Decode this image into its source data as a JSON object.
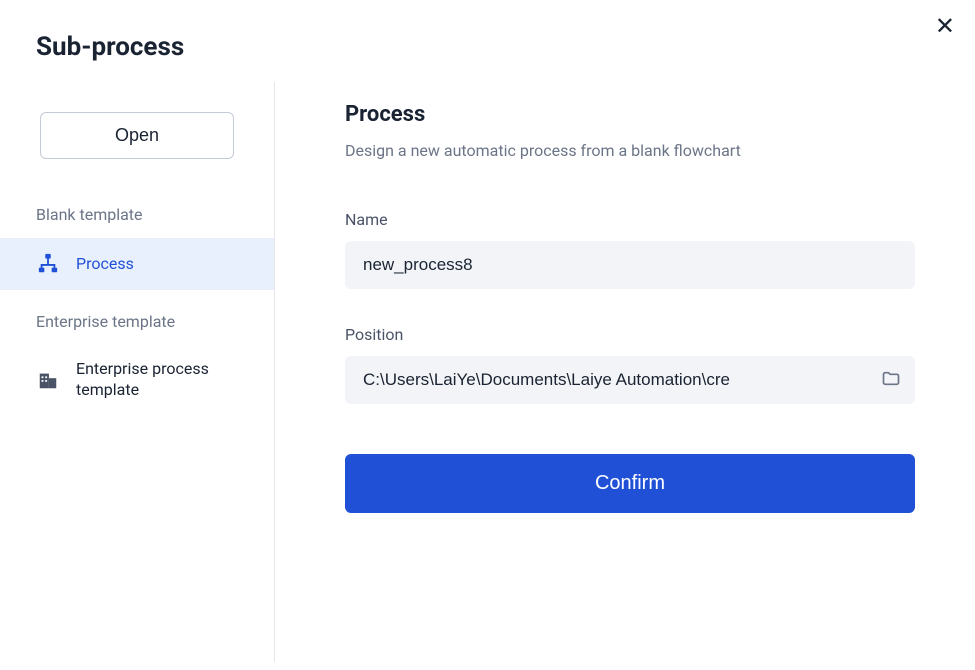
{
  "dialog": {
    "title": "Sub-process"
  },
  "sidebar": {
    "open_label": "Open",
    "section_blank_label": "Blank template",
    "section_enterprise_label": "Enterprise template",
    "items": {
      "process": {
        "label": "Process"
      },
      "enterprise": {
        "label": "Enterprise process template"
      }
    }
  },
  "main": {
    "title": "Process",
    "subtitle": "Design a new automatic process from a blank flowchart",
    "name_label": "Name",
    "name_value": "new_process8",
    "position_label": "Position",
    "position_value": "C:\\Users\\LaiYe\\Documents\\Laiye Automation\\cre",
    "confirm_label": "Confirm"
  }
}
